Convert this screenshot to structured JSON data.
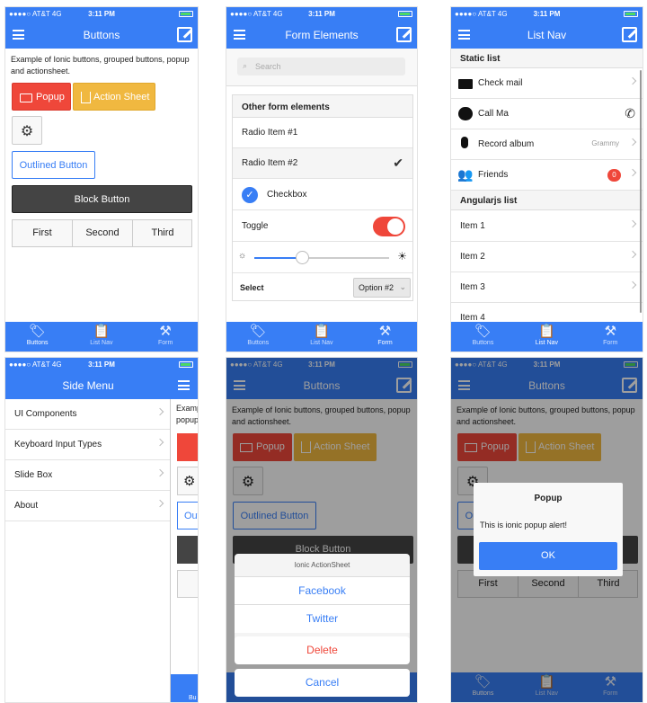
{
  "status": {
    "carrier": "●●●●○ AT&T  4G",
    "time": "3:11 PM"
  },
  "screen1": {
    "title": "Buttons",
    "intro": "Example of Ionic buttons, grouped buttons, popup and actionsheet.",
    "popup_label": "Popup",
    "actionsheet_label": "Action Sheet",
    "outlined_label": "Outlined Button",
    "block_label": "Block Button",
    "group": [
      "First",
      "Second",
      "Third"
    ]
  },
  "screen2": {
    "title": "Form Elements",
    "search_placeholder": "Search",
    "section": "Other form elements",
    "radio1": "Radio Item #1",
    "radio2": "Radio Item #2",
    "checkbox": "Checkbox",
    "toggle": "Toggle",
    "range_value": 0.35,
    "select_label": "Select",
    "select_value": "Option #2"
  },
  "screen3": {
    "title": "List Nav",
    "static_header": "Static list",
    "check_mail": "Check mail",
    "call": "Call Ma",
    "record": "Record album",
    "record_note": "Grammy",
    "friends": "Friends",
    "friends_badge": "0",
    "angular_header": "Angularjs list",
    "items": [
      "Item 1",
      "Item 2",
      "Item 3",
      "Item 4"
    ]
  },
  "screen4": {
    "title": "Side Menu",
    "items": [
      "UI Components",
      "Keyboard Input Types",
      "Slide Box",
      "About"
    ],
    "peek_text1": "Examp",
    "peek_text2": "popup",
    "peek_outlined": "Out",
    "peek_tab": "Bu"
  },
  "screen5": {
    "sheet_title": "Ionic ActionSheet",
    "facebook": "Facebook",
    "twitter": "Twitter",
    "delete": "Delete",
    "cancel": "Cancel"
  },
  "screen6": {
    "popup_title": "Popup",
    "popup_body": "This is ionic popup alert!",
    "ok": "OK"
  },
  "tabs": [
    "Buttons",
    "List Nav",
    "Form"
  ],
  "colors": {
    "primary": "#387ef5",
    "assertive": "#ef473a",
    "energized": "#f0b840",
    "dark": "#444444",
    "balanced": "#4cd964"
  }
}
